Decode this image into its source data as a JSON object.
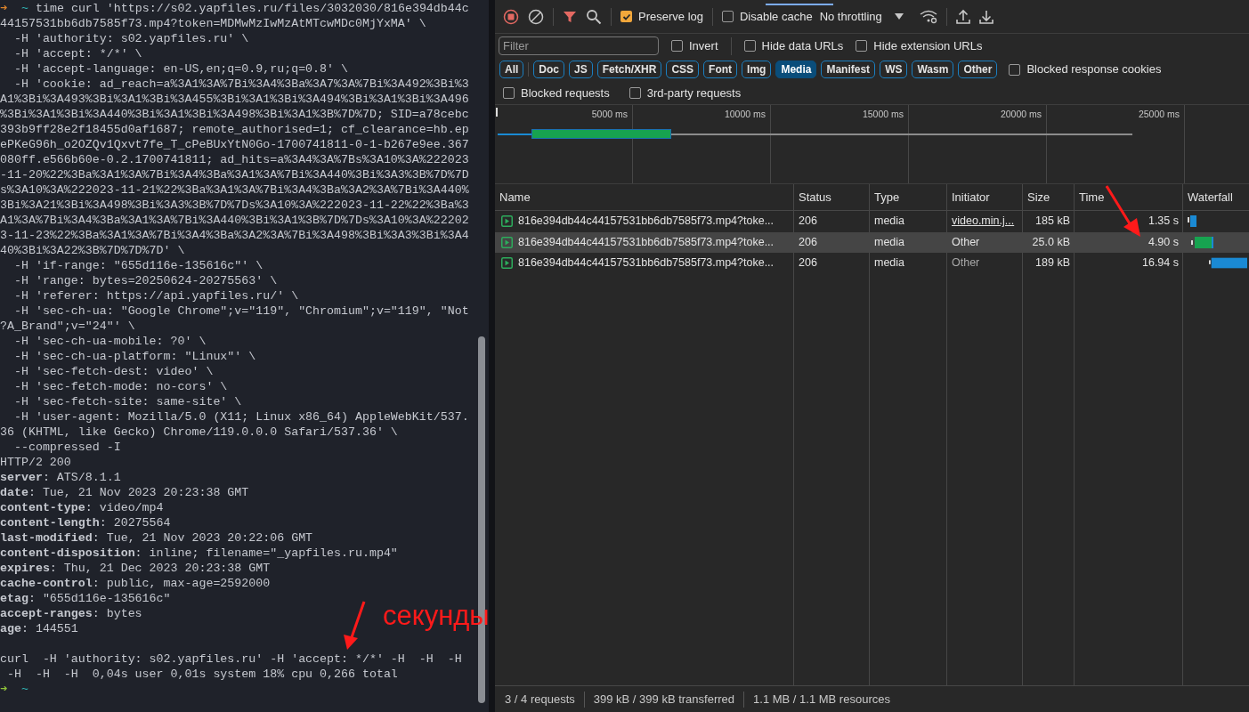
{
  "terminal": {
    "lines": [
      {
        "kind": "prompt",
        "success": false,
        "arrow": "➜",
        "cwd": "~",
        "text": "time curl 'https://s02.yapfiles.ru/files/3032030/816e394db44c"
      },
      {
        "kind": "plain",
        "text": "44157531bb6db7585f73.mp4?token=MDMwMzIwMzAtMTcwMDc0MjYxMA' \\"
      },
      {
        "kind": "plain",
        "text": "  -H 'authority: s02.yapfiles.ru' \\"
      },
      {
        "kind": "plain",
        "text": "  -H 'accept: */*' \\"
      },
      {
        "kind": "plain",
        "text": "  -H 'accept-language: en-US,en;q=0.9,ru;q=0.8' \\"
      },
      {
        "kind": "plain",
        "text": "  -H 'cookie: ad_reach=a%3A1%3A%7Bi%3A4%3Ba%3A7%3A%7Bi%3A492%3Bi%3"
      },
      {
        "kind": "plain",
        "text": "A1%3Bi%3A493%3Bi%3A1%3Bi%3A455%3Bi%3A1%3Bi%3A494%3Bi%3A1%3Bi%3A496"
      },
      {
        "kind": "plain",
        "text": "%3Bi%3A1%3Bi%3A440%3Bi%3A1%3Bi%3A498%3Bi%3A1%3B%7D%7D; SID=a78cebc"
      },
      {
        "kind": "plain",
        "text": "393b9ff28e2f18455d0af1687; remote_authorised=1; cf_clearance=hb.ep"
      },
      {
        "kind": "plain",
        "text": "ePKeG96h_o2OZQv1Qxvt7fe_T_cPeBUxYtN0Go-1700741811-0-1-b267e9ee.367"
      },
      {
        "kind": "plain",
        "text": "080ff.e566b60e-0.2.1700741811; ad_hits=a%3A4%3A%7Bs%3A10%3A%222023"
      },
      {
        "kind": "plain",
        "text": "-11-20%22%3Ba%3A1%3A%7Bi%3A4%3Ba%3A1%3A%7Bi%3A440%3Bi%3A3%3B%7D%7D"
      },
      {
        "kind": "plain",
        "text": "s%3A10%3A%222023-11-21%22%3Ba%3A1%3A%7Bi%3A4%3Ba%3A2%3A%7Bi%3A440%"
      },
      {
        "kind": "plain",
        "text": "3Bi%3A21%3Bi%3A498%3Bi%3A3%3B%7D%7Ds%3A10%3A%222023-11-22%22%3Ba%3"
      },
      {
        "kind": "plain",
        "text": "A1%3A%7Bi%3A4%3Ba%3A1%3A%7Bi%3A440%3Bi%3A1%3B%7D%7Ds%3A10%3A%22202"
      },
      {
        "kind": "plain",
        "text": "3-11-23%22%3Ba%3A1%3A%7Bi%3A4%3Ba%3A2%3A%7Bi%3A498%3Bi%3A3%3Bi%3A4"
      },
      {
        "kind": "plain",
        "text": "40%3Bi%3A22%3B%7D%7D%7D' \\"
      },
      {
        "kind": "plain",
        "text": "  -H 'if-range: \"655d116e-135616c\"' \\"
      },
      {
        "kind": "plain",
        "text": "  -H 'range: bytes=20250624-20275563' \\"
      },
      {
        "kind": "plain",
        "text": "  -H 'referer: https://api.yapfiles.ru/' \\"
      },
      {
        "kind": "plain",
        "text": "  -H 'sec-ch-ua: \"Google Chrome\";v=\"119\", \"Chromium\";v=\"119\", \"Not"
      },
      {
        "kind": "plain",
        "text": "?A_Brand\";v=\"24\"' \\"
      },
      {
        "kind": "plain",
        "text": "  -H 'sec-ch-ua-mobile: ?0' \\"
      },
      {
        "kind": "plain",
        "text": "  -H 'sec-ch-ua-platform: \"Linux\"' \\"
      },
      {
        "kind": "plain",
        "text": "  -H 'sec-fetch-dest: video' \\"
      },
      {
        "kind": "plain",
        "text": "  -H 'sec-fetch-mode: no-cors' \\"
      },
      {
        "kind": "plain",
        "text": "  -H 'sec-fetch-site: same-site' \\"
      },
      {
        "kind": "plain",
        "text": "  -H 'user-agent: Mozilla/5.0 (X11; Linux x86_64) AppleWebKit/537."
      },
      {
        "kind": "plain",
        "text": "36 (KHTML, like Gecko) Chrome/119.0.0.0 Safari/537.36' \\"
      },
      {
        "kind": "plain",
        "text": "  --compressed -I"
      },
      {
        "kind": "plain",
        "text": "HTTP/2 200"
      },
      {
        "kind": "header",
        "text": "**server**: ATS/8.1.1"
      },
      {
        "kind": "header",
        "text": "**date**: Tue, 21 Nov 2023 20:23:38 GMT"
      },
      {
        "kind": "header",
        "text": "**content-type**: video/mp4"
      },
      {
        "kind": "header",
        "text": "**content-length**: 20275564"
      },
      {
        "kind": "header",
        "text": "**last-modified**: Tue, 21 Nov 2023 20:22:06 GMT"
      },
      {
        "kind": "header",
        "text": "**content-disposition**: inline; filename=\"_yapfiles.ru.mp4\""
      },
      {
        "kind": "header",
        "text": "**expires**: Thu, 21 Dec 2023 20:23:38 GMT"
      },
      {
        "kind": "header",
        "text": "**cache-control**: public, max-age=2592000"
      },
      {
        "kind": "header",
        "text": "**etag**: \"655d116e-135616c\""
      },
      {
        "kind": "header",
        "text": "**accept-ranges**: bytes"
      },
      {
        "kind": "header",
        "text": "**age**: 144551"
      },
      {
        "kind": "blank"
      },
      {
        "kind": "plain",
        "text": "curl  -H 'authority: s02.yapfiles.ru' -H 'accept: */*' -H  -H  -H"
      },
      {
        "kind": "plain",
        "text": " -H  -H  -H  0,04s user 0,01s system 18% cpu 0,266 total"
      },
      {
        "kind": "prompt",
        "success": true,
        "arrow": "➜",
        "cwd": "~"
      }
    ]
  },
  "devtools": {
    "toolbar": {
      "recording": true,
      "filter_active": true,
      "checkboxes": [
        {
          "label": "Preserve log",
          "checked": true
        },
        {
          "label": "Disable cache",
          "checked": false
        }
      ],
      "throttling": "No throttling"
    },
    "filter": {
      "placeholder": "Filter",
      "checkboxes": [
        {
          "label": "Invert",
          "checked": false
        },
        {
          "label": "Hide data URLs",
          "checked": false
        },
        {
          "label": "Hide extension URLs",
          "checked": false
        }
      ]
    },
    "types": [
      {
        "label": "All",
        "selected": false
      },
      {
        "label": "Doc",
        "selected": false
      },
      {
        "label": "JS",
        "selected": false
      },
      {
        "label": "Fetch/XHR",
        "selected": false
      },
      {
        "label": "CSS",
        "selected": false
      },
      {
        "label": "Font",
        "selected": false
      },
      {
        "label": "Img",
        "selected": false
      },
      {
        "label": "Media",
        "selected": true
      },
      {
        "label": "Manifest",
        "selected": false
      },
      {
        "label": "WS",
        "selected": false
      },
      {
        "label": "Wasm",
        "selected": false
      },
      {
        "label": "Other",
        "selected": false
      }
    ],
    "type_checkbox": {
      "label": "Blocked response cookies",
      "checked": false
    },
    "more_checkboxes": [
      {
        "label": "Blocked requests",
        "checked": false
      },
      {
        "label": "3rd-party requests",
        "checked": false
      }
    ],
    "timeline_ticks": [
      "5000 ms",
      "10000 ms",
      "15000 ms",
      "20000 ms",
      "25000 ms"
    ],
    "table": {
      "columns": [
        "Name",
        "Status",
        "Type",
        "Initiator",
        "Size",
        "Time",
        "Waterfall"
      ],
      "rows": [
        {
          "name": "816e394db44c44157531bb6db7585f73.mp4?toke...",
          "status": "206",
          "type": "media",
          "initiator": "video.min.j...",
          "initiator_link": true,
          "size": "185 kB",
          "time": "1.35 s",
          "selected": false
        },
        {
          "name": "816e394db44c44157531bb6db7585f73.mp4?toke...",
          "status": "206",
          "type": "media",
          "initiator": "Other",
          "initiator_link": false,
          "size": "25.0 kB",
          "time": "4.90 s",
          "selected": true
        },
        {
          "name": "816e394db44c44157531bb6db7585f73.mp4?toke...",
          "status": "206",
          "type": "media",
          "initiator": "Other",
          "initiator_link": false,
          "size": "189 kB",
          "time": "16.94 s",
          "selected": false
        }
      ]
    },
    "status_bar": [
      "3 / 4 requests",
      "399 kB / 399 kB transferred",
      "1.1 MB / 1.1 MB resources"
    ]
  },
  "annotation": {
    "label": "секунды"
  }
}
